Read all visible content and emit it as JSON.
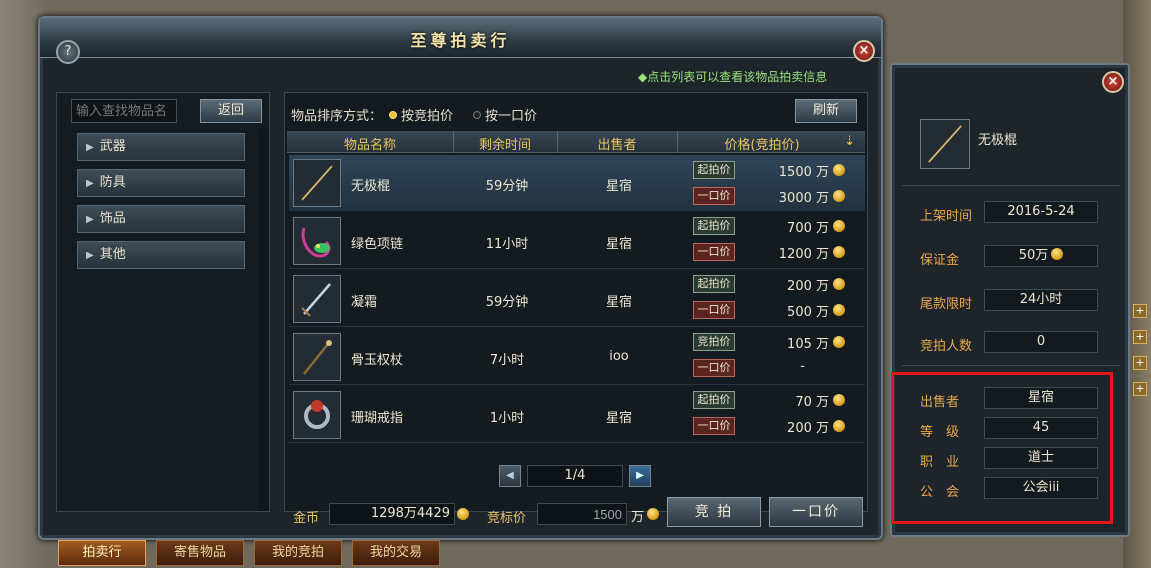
{
  "window": {
    "title": "至尊拍卖行",
    "help_label": "?",
    "close_label": "×",
    "hint": "◆点击列表可以查看该物品拍卖信息"
  },
  "left_panel": {
    "search_placeholder": "输入查找物品名",
    "back_label": "返回",
    "categories": [
      "武器",
      "防具",
      "饰品",
      "其他"
    ]
  },
  "list": {
    "sort_label": "物品排序方式：",
    "sort_options": [
      {
        "label": "按竞拍价",
        "selected": true
      },
      {
        "label": "按一口价",
        "selected": false
      }
    ],
    "refresh_label": "刷新",
    "columns": [
      "物品名称",
      "剩余时间",
      "出售者",
      "价格(竞拍价)"
    ],
    "rows": [
      {
        "name": "无极棍",
        "time": "59分钟",
        "seller": "星宿",
        "tag1": "起拍价",
        "price1": "1500 万",
        "tag2": "一口价",
        "price2": "3000 万",
        "selected": true,
        "icon": "staff-icon"
      },
      {
        "name": "绿色项链",
        "time": "11小时",
        "seller": "星宿",
        "tag1": "起拍价",
        "price1": "700 万",
        "tag2": "一口价",
        "price2": "1200 万",
        "selected": false,
        "icon": "necklace-icon"
      },
      {
        "name": "凝霜",
        "time": "59分钟",
        "seller": "星宿",
        "tag1": "起拍价",
        "price1": "200 万",
        "tag2": "一口价",
        "price2": "500 万",
        "selected": false,
        "icon": "sword-icon"
      },
      {
        "name": "骨玉权杖",
        "time": "7小时",
        "seller": "ioo",
        "tag1": "竞拍价",
        "price1": "105 万",
        "tag2": "一口价",
        "price2": "-",
        "selected": false,
        "icon": "scepter-icon"
      },
      {
        "name": "珊瑚戒指",
        "time": "1小时",
        "seller": "星宿",
        "tag1": "起拍价",
        "price1": "70 万",
        "tag2": "一口价",
        "price2": "200 万",
        "selected": false,
        "icon": "ring-icon"
      }
    ],
    "page": "1/4",
    "gold_label": "金币",
    "gold_value": "1298万4429",
    "bid_label": "竞标价",
    "bid_value": "1500",
    "bid_unit": "万",
    "bid_button": "竞 拍",
    "buyout_button": "一口价"
  },
  "tabs": [
    {
      "label": "拍卖行",
      "active": true
    },
    {
      "label": "寄售物品",
      "active": false
    },
    {
      "label": "我的竞拍",
      "active": false
    },
    {
      "label": "我的交易",
      "active": false
    }
  ],
  "detail": {
    "close_label": "×",
    "item_name": "无极棍",
    "fields": [
      {
        "label": "上架时间",
        "value": "2016-5-24"
      },
      {
        "label": "保证金",
        "value": "50万"
      },
      {
        "label": "尾款限时",
        "value": "24小时"
      },
      {
        "label": "竞拍人数",
        "value": "0"
      },
      {
        "label": "出售者",
        "value": "星宿"
      },
      {
        "label": "等　级",
        "value": "45"
      },
      {
        "label": "职　业",
        "value": "道士"
      },
      {
        "label": "公　会",
        "value": "公会iii"
      }
    ]
  },
  "colors": {
    "accent_gold": "#e8c560",
    "label_orange": "#e8a84a",
    "highlight_red": "#e01818",
    "hint_green": "#9be27a"
  }
}
